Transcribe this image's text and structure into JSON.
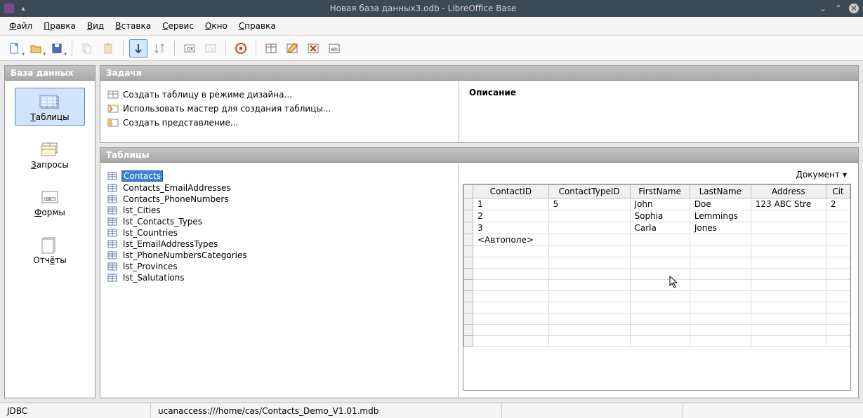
{
  "title": "Новая база данных3.odb - LibreOffice Base",
  "menu": {
    "items": [
      "Файл",
      "Правка",
      "Вид",
      "Вставка",
      "Сервис",
      "Окно",
      "Справка"
    ]
  },
  "db_panel": {
    "header": "База данных",
    "items": [
      {
        "key": "tables",
        "label": "Таблицы",
        "underline": 0,
        "selected": true
      },
      {
        "key": "queries",
        "label": "Запросы",
        "underline": 0,
        "selected": false
      },
      {
        "key": "forms",
        "label": "Формы",
        "underline": 0,
        "selected": false
      },
      {
        "key": "reports",
        "label": "Отчёты",
        "underline": 3,
        "selected": false
      }
    ]
  },
  "tasks": {
    "header": "Задачи",
    "items": [
      "Создать таблицу в режиме дизайна...",
      "Использовать мастер для создания таблицы...",
      "Создать представление..."
    ],
    "description_title": "Описание"
  },
  "tables_panel": {
    "header": "Таблицы",
    "list": [
      {
        "name": "Contacts",
        "selected": true
      },
      {
        "name": "Contacts_EmailAddresses"
      },
      {
        "name": "Contacts_PhoneNumbers"
      },
      {
        "name": "lst_Cities"
      },
      {
        "name": "lst_Contacts_Types"
      },
      {
        "name": "lst_Countries"
      },
      {
        "name": "lst_EmailAddressTypes"
      },
      {
        "name": "lst_PhoneNumbersCategories"
      },
      {
        "name": "lst_Provinces"
      },
      {
        "name": "lst_Salutations"
      }
    ]
  },
  "preview": {
    "doc_button": "Документ",
    "columns": [
      "ContactID",
      "ContactTypeID",
      "FirstName",
      "LastName",
      "Address",
      "Cit"
    ],
    "rows": [
      {
        "ContactID": "1",
        "ContactTypeID": "5",
        "FirstName": "John",
        "LastName": "Doe",
        "Address": "123 ABC Stre",
        "Cit": "2"
      },
      {
        "ContactID": "2",
        "ContactTypeID": "",
        "FirstName": "Sophia",
        "LastName": "Lemmings",
        "Address": "",
        "Cit": ""
      },
      {
        "ContactID": "3",
        "ContactTypeID": "",
        "FirstName": "Carla",
        "LastName": "Jones",
        "Address": "",
        "Cit": ""
      }
    ],
    "autofield": "<Автополе>"
  },
  "status": {
    "driver": "JDBC",
    "path": "ucanaccess:///home/cas/Contacts_Demo_V1.01.mdb"
  },
  "chart_data": {
    "type": "table",
    "title": "Contacts",
    "columns": [
      "ContactID",
      "ContactTypeID",
      "FirstName",
      "LastName",
      "Address",
      "Cit"
    ],
    "rows": [
      [
        "1",
        "5",
        "John",
        "Doe",
        "123 ABC Stre",
        "2"
      ],
      [
        "2",
        "",
        "Sophia",
        "Lemmings",
        "",
        ""
      ],
      [
        "3",
        "",
        "Carla",
        "Jones",
        "",
        ""
      ]
    ]
  }
}
